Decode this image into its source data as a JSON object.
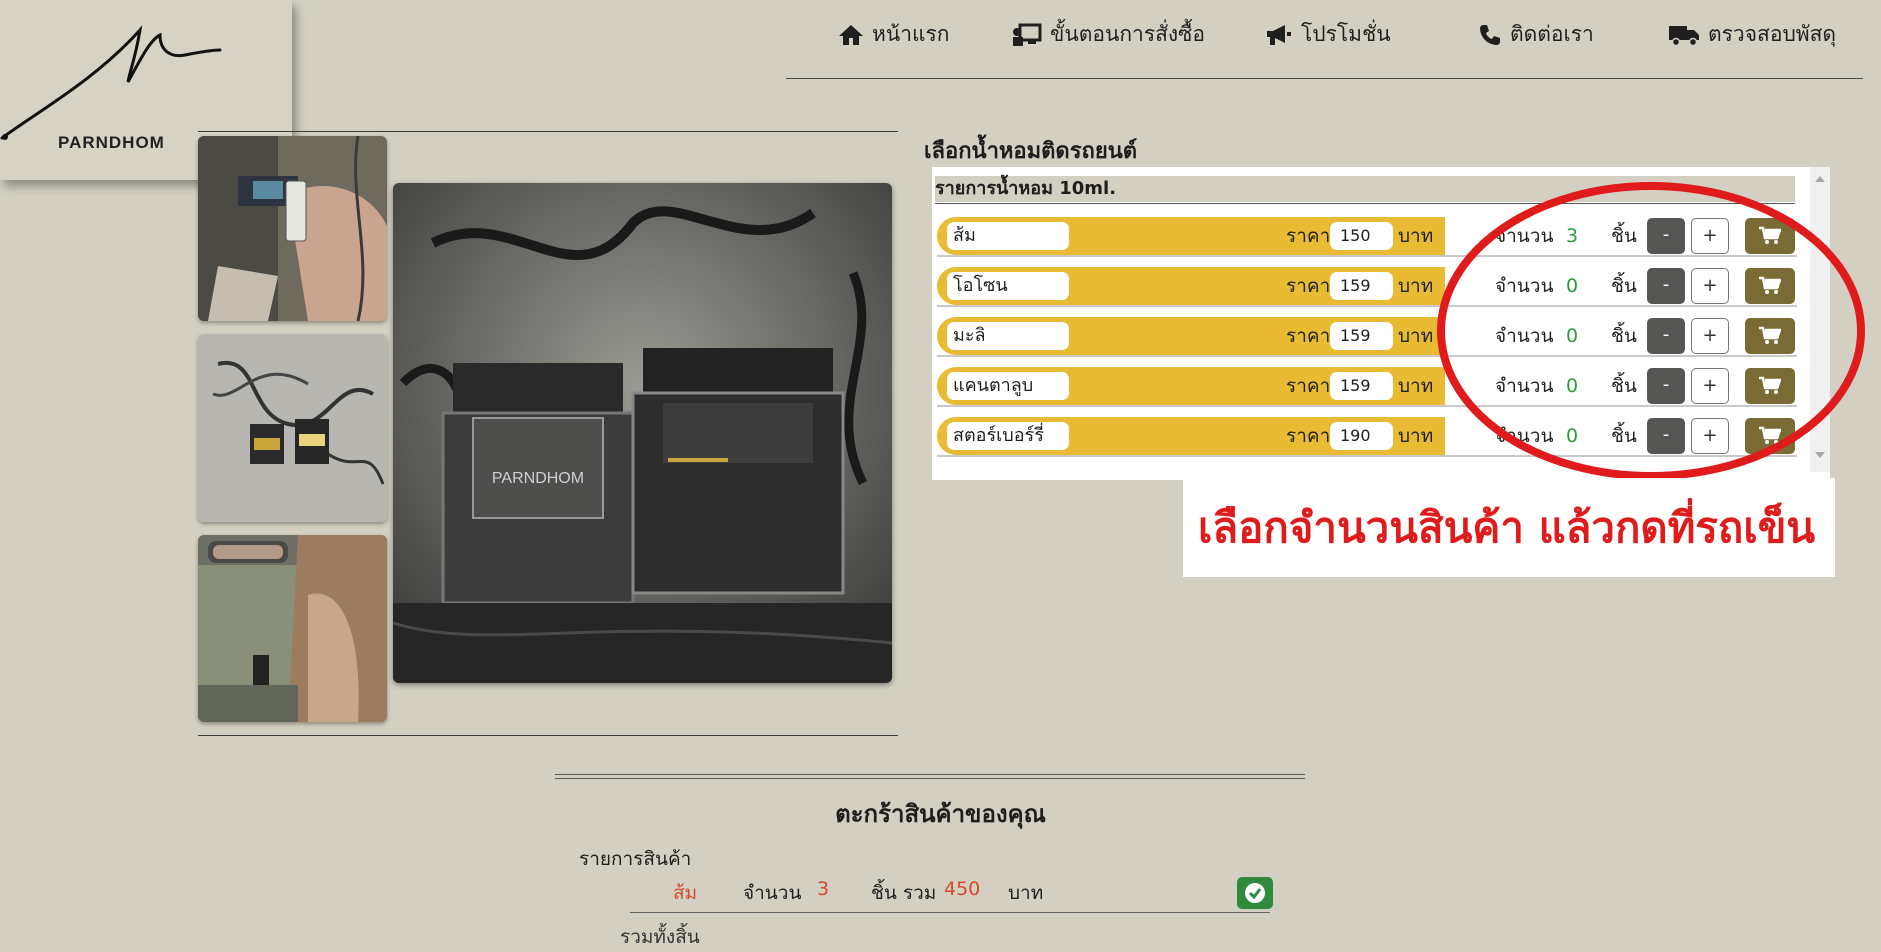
{
  "logo": {
    "text": "PARNDHOM"
  },
  "nav": {
    "items": [
      {
        "label": "หน้าแรก",
        "icon": "home-icon"
      },
      {
        "label": "ขั้นตอนการสั่งซื้อ",
        "icon": "presentation-icon"
      },
      {
        "label": "โปรโมชั่น",
        "icon": "megaphone-icon"
      },
      {
        "label": "ติดต่อเรา",
        "icon": "phone-icon"
      },
      {
        "label": "ตรวจสอบพัสดุ",
        "icon": "truck-icon"
      }
    ]
  },
  "product_section": {
    "title": "เลือกน้ำหอมติดรถยนต์",
    "list_header_prefix": "รายการน้ำหอม",
    "list_header_size": "10ml.",
    "price_label": "ราคา",
    "currency_label": "บาท",
    "qty_label": "จำนวน",
    "unit_label": "ชิ้น",
    "minus_label": "-",
    "plus_label": "+",
    "items": [
      {
        "name": "ส้ม",
        "price": "150",
        "qty": "3"
      },
      {
        "name": "โอโซน",
        "price": "159",
        "qty": "0"
      },
      {
        "name": "มะลิ",
        "price": "159",
        "qty": "0"
      },
      {
        "name": "แคนตาลูบ",
        "price": "159",
        "qty": "0"
      },
      {
        "name": "สตอร์เบอร์รี่",
        "price": "190",
        "qty": "0"
      }
    ]
  },
  "annotation": {
    "text": "เลือกจำนวนสินค้า แล้วกดที่รถเข็น",
    "color": "#e01b1b"
  },
  "cart": {
    "title": "ตะกร้าสินค้าของคุณ",
    "subtitle": "รายการสินค้า",
    "item": {
      "name": "ส้ม",
      "qty_label": "จำนวน",
      "qty": "3",
      "unit_total_label": "ชิ้น รวม",
      "total": "450",
      "currency_label": "บาท"
    },
    "next_line": "รวมทั้งสิ้น"
  },
  "colors": {
    "background": "#d3d0c3",
    "row_bar": "#e8bb32",
    "qty_green": "#2e9b3a",
    "cart_button": "#7a6a34",
    "minus_button": "#555553",
    "check_button": "#2f8a3c"
  }
}
